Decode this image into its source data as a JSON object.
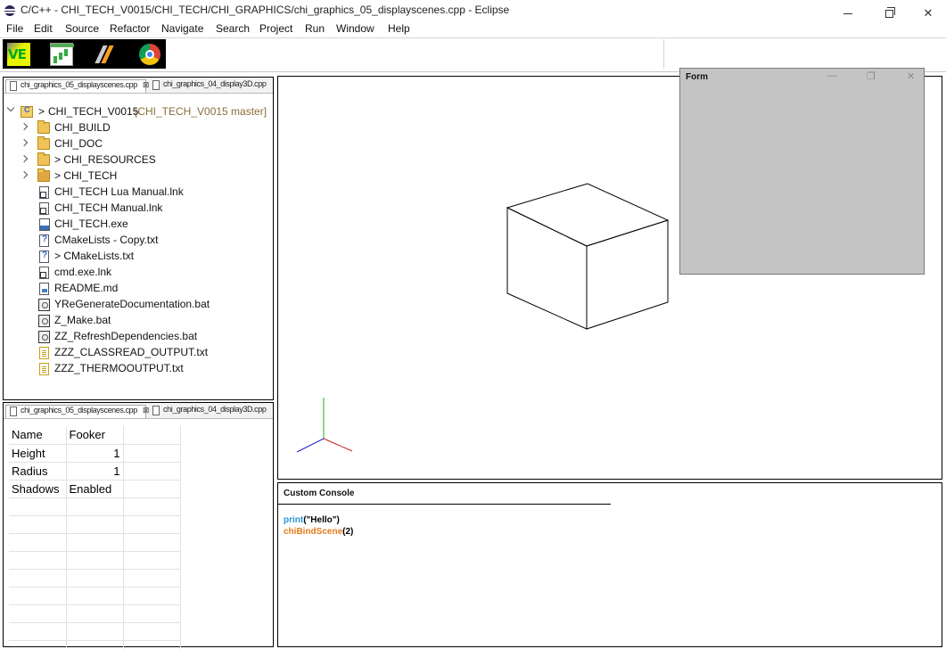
{
  "window": {
    "title": "C/C++ - CHI_TECH_V0015/CHI_TECH/CHI_GRAPHICS/chi_graphics_05_displayscenes.cpp - Eclipse",
    "minimize_glyph": "—",
    "maximize_glyph": "❐",
    "close_glyph": "✕"
  },
  "menu": [
    "File",
    "Edit",
    "Source",
    "Refactor",
    "Navigate",
    "Search",
    "Project",
    "Run",
    "Window",
    "Help"
  ],
  "toolbar": {
    "buttons": [
      {
        "icon": "ve-app-icon",
        "label": "VE"
      },
      {
        "icon": "chart-app-icon"
      },
      {
        "icon": "lightning-app-icon"
      },
      {
        "icon": "chrome-icon"
      }
    ]
  },
  "explorer": {
    "tabs": [
      "chi_graphics_05_displayscenes.cpp",
      "chi_graphics_04_display3D.cpp"
    ],
    "tab_close": "⊠",
    "project": {
      "prefix": ">",
      "name": "CHI_TECH_V0015",
      "git": "[CHI_TECH_V0015 master]"
    },
    "items": [
      {
        "label": "CHI_BUILD",
        "icon": "folder-icon",
        "expandable": true
      },
      {
        "label": "CHI_DOC",
        "icon": "folder-icon",
        "expandable": true
      },
      {
        "label": "> CHI_RESOURCES",
        "icon": "folder-icon",
        "expandable": true
      },
      {
        "label": "> CHI_TECH",
        "icon": "source-folder-icon",
        "expandable": true
      },
      {
        "label": "CHI_TECH Lua Manual.lnk",
        "icon": "link-file-icon"
      },
      {
        "label": "CHI_TECH Manual.lnk",
        "icon": "link-file-icon"
      },
      {
        "label": "CHI_TECH.exe",
        "icon": "exe-file-icon"
      },
      {
        "label": "CMakeLists - Copy.txt",
        "icon": "cmake-file-icon"
      },
      {
        "label": "> CMakeLists.txt",
        "icon": "cmake-file-icon"
      },
      {
        "label": "cmd.exe.lnk",
        "icon": "link-file-icon"
      },
      {
        "label": "README.md",
        "icon": "markdown-file-icon"
      },
      {
        "label": "YReGenerateDocumentation.bat",
        "icon": "batch-file-icon"
      },
      {
        "label": "Z_Make.bat",
        "icon": "batch-file-icon"
      },
      {
        "label": "ZZ_RefreshDependencies.bat",
        "icon": "batch-file-icon"
      },
      {
        "label": "ZZZ_CLASSREAD_OUTPUT.txt",
        "icon": "text-file-icon"
      },
      {
        "label": "ZZZ_THERMOOUTPUT.txt",
        "icon": "text-file-icon"
      }
    ]
  },
  "properties": {
    "tabs": [
      "chi_graphics_05_displayscenes.cpp",
      "chi_graphics_04_display3D.cpp"
    ],
    "tab_close": "⊠",
    "rows": [
      {
        "key": "Name",
        "value": "Fooker"
      },
      {
        "key": "Height",
        "value": "1"
      },
      {
        "key": "Radius",
        "value": "1"
      },
      {
        "key": "Shadows",
        "value": "Enabled"
      }
    ],
    "empty_rows": 9
  },
  "form": {
    "title": "Form",
    "minimize_glyph": "—",
    "maximize_glyph": "❐",
    "close_glyph": "✕"
  },
  "console": {
    "title": "Custom Console",
    "lines": [
      {
        "func": "print",
        "args": "(\"Hello\")",
        "color": "#2a93d5"
      },
      {
        "func": "chiBindScene",
        "args": "(2)",
        "color": "#e47b1a"
      }
    ]
  },
  "viewport": {
    "axis_colors": {
      "x": "#cc2222",
      "y": "#22aa22",
      "z": "#2222cc"
    },
    "cube_color": "#000000"
  }
}
